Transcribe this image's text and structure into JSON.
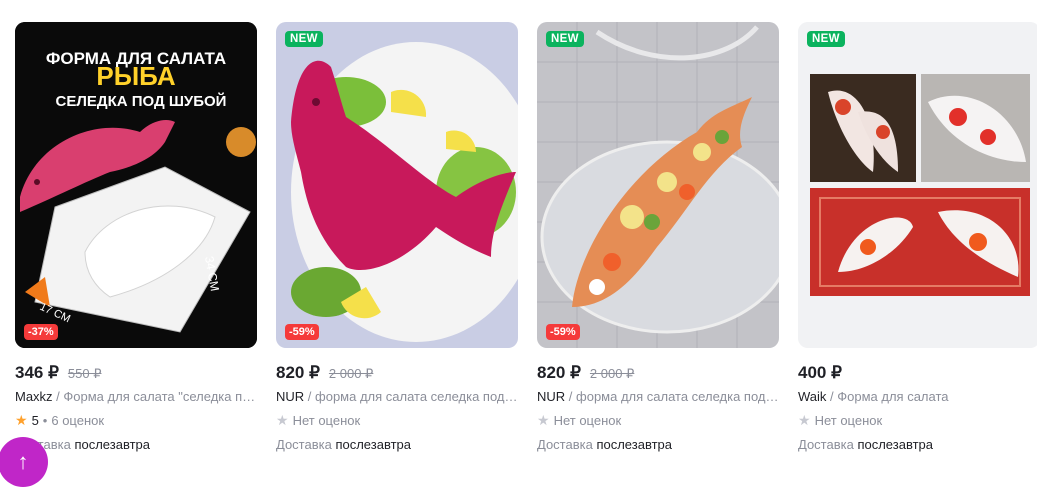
{
  "products": [
    {
      "price": "346 ₽",
      "old_price": "550 ₽",
      "brand": "Maxkz",
      "title": "Форма для салата \"селедка под шубой\"",
      "rating_value": "5",
      "rating_text": "6 оценок",
      "discount": "-37%",
      "new_badge": "",
      "delivery_label": "Доставка",
      "delivery_when": "послезавтра",
      "image_text": [
        "ФОРМА ДЛЯ САЛАТА",
        "РЫБА",
        "СЕЛЕДКА ПОД ШУБОЙ",
        "17 СМ",
        "34 СМ"
      ]
    },
    {
      "price": "820 ₽",
      "old_price": "2 000 ₽",
      "brand": "NUR",
      "title": "форма для салата селедка под шубой",
      "rating_text": "Нет оценок",
      "discount": "-59%",
      "new_badge": "NEW",
      "delivery_label": "Доставка",
      "delivery_when": "послезавтра"
    },
    {
      "price": "820 ₽",
      "old_price": "2 000 ₽",
      "brand": "NUR",
      "title": "форма для салата селедка под шубой",
      "rating_text": "Нет оценок",
      "discount": "-59%",
      "new_badge": "NEW",
      "delivery_label": "Доставка",
      "delivery_when": "послезавтра"
    },
    {
      "price": "400 ₽",
      "brand": "Waik",
      "title": "Форма для салата",
      "rating_text": "Нет оценок",
      "new_badge": "NEW",
      "delivery_label": "Доставка",
      "delivery_when": "послезавтра"
    }
  ],
  "icons": {
    "star_filled": "star-icon",
    "star_empty": "star-outline-icon",
    "scroll_top": "arrow-up-icon"
  },
  "colors": {
    "star_gold": "#ffa12c",
    "star_grey": "#c7c9d1",
    "new_badge": "#0bb35e",
    "discount_badge": "#f53a3a",
    "fab": "#c026c8"
  }
}
